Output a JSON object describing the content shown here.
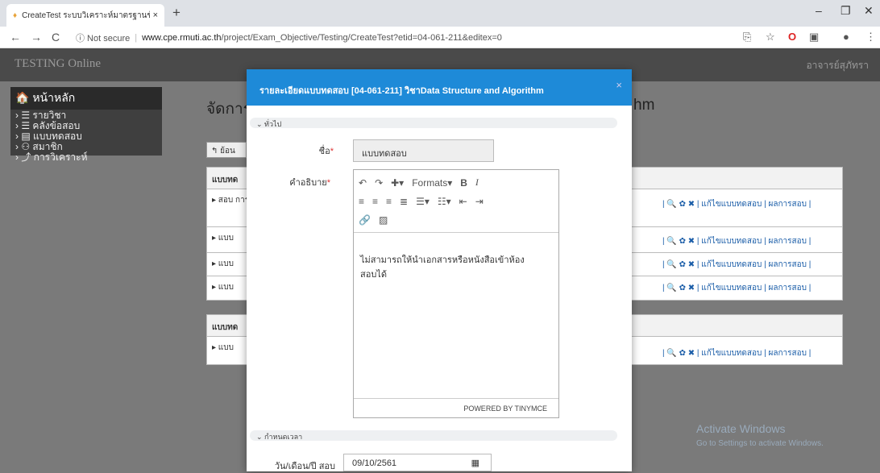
{
  "browser": {
    "tab_title": "CreateTest ระบบวิเคราะห์มาตรฐานข้…",
    "close": "×",
    "new_tab": "+",
    "min": "–",
    "max": "❐",
    "close_win": "✕",
    "security": "ⓘ Not secure",
    "url_host": "www.cpe.rmuti.ac.th",
    "url_path": "/project/Exam_Objective/Testing/CreateTest?etid=04-061-211&editex=0"
  },
  "navbar": {
    "brand": "TESTING Online",
    "user": "อาจารย์สุภัทรา"
  },
  "sidebar": {
    "head": "หน้าหลัก",
    "items": [
      "รายวิชา",
      "คลังข้อสอบ",
      "แบบทดสอบ",
      "สมาชิก",
      "การวิเคราะห์"
    ]
  },
  "background": {
    "heading_left": "จัดการ",
    "heading_right": "hm",
    "back": "ย้อน",
    "panel1": "แบบทด",
    "panel2": "แบบทด",
    "row_texts": [
      "▸ สอบ\nการวิเ",
      "▸ แบบ",
      "▸ แบบ",
      "▸ แบบ",
      "▸ แบบ"
    ],
    "actions": "| 🔍 ✿ ✖ | แก้ไขแบบทดสอบ | ผลการสอบ |"
  },
  "modal": {
    "title": "รายละเอียดแบบทดสอบ [04-061-211] วิชาData Structure and Algorithm",
    "section1": "ทั่วไป",
    "name_label": "ชื่อ",
    "name_value": "แบบทดสอบ",
    "desc_label": "คำอธิบาย",
    "formats": "Formats",
    "editor_text": "ไม่สามารถให้นำเอกสารหรือหนังสือเข้าห้องสอบได้",
    "powered": "POWERED BY TINYMCE",
    "section2": "กำหนดเวลา",
    "date_label": "วัน/เดือน/ปี สอบ",
    "date_value": "09/10/2561"
  },
  "watermark": {
    "title": "Activate Windows",
    "sub": "Go to Settings to activate Windows."
  }
}
